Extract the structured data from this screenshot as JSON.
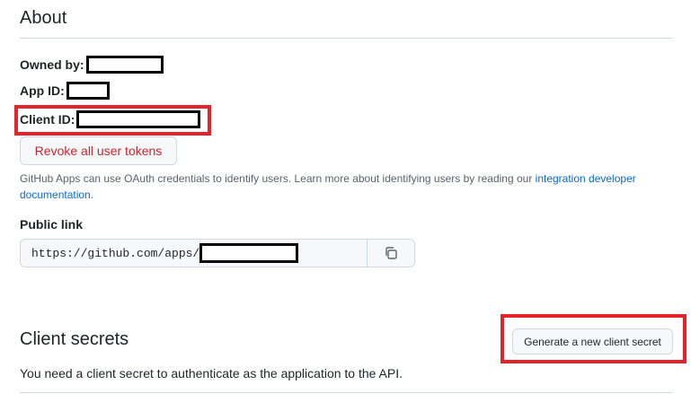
{
  "about": {
    "title": "About",
    "owned_by_label": "Owned by:",
    "app_id_label": "App ID:",
    "client_id_label": "Client ID:",
    "revoke_label": "Revoke all user tokens",
    "help_text_prefix": "GitHub Apps can use OAuth credentials to identify users. Learn more about identifying users by reading our ",
    "help_link": "integration developer documentation",
    "help_text_suffix": ".",
    "public_link_label": "Public link",
    "public_link_value": "https://github.com/apps/",
    "copy_icon": "copy-icon"
  },
  "client_secrets": {
    "title": "Client secrets",
    "generate_label": "Generate a new client secret",
    "description": "You need a client secret to authenticate as the application to the API."
  },
  "colors": {
    "highlight": "#e3242b",
    "danger_text": "#cf222e",
    "link": "#0969da"
  }
}
